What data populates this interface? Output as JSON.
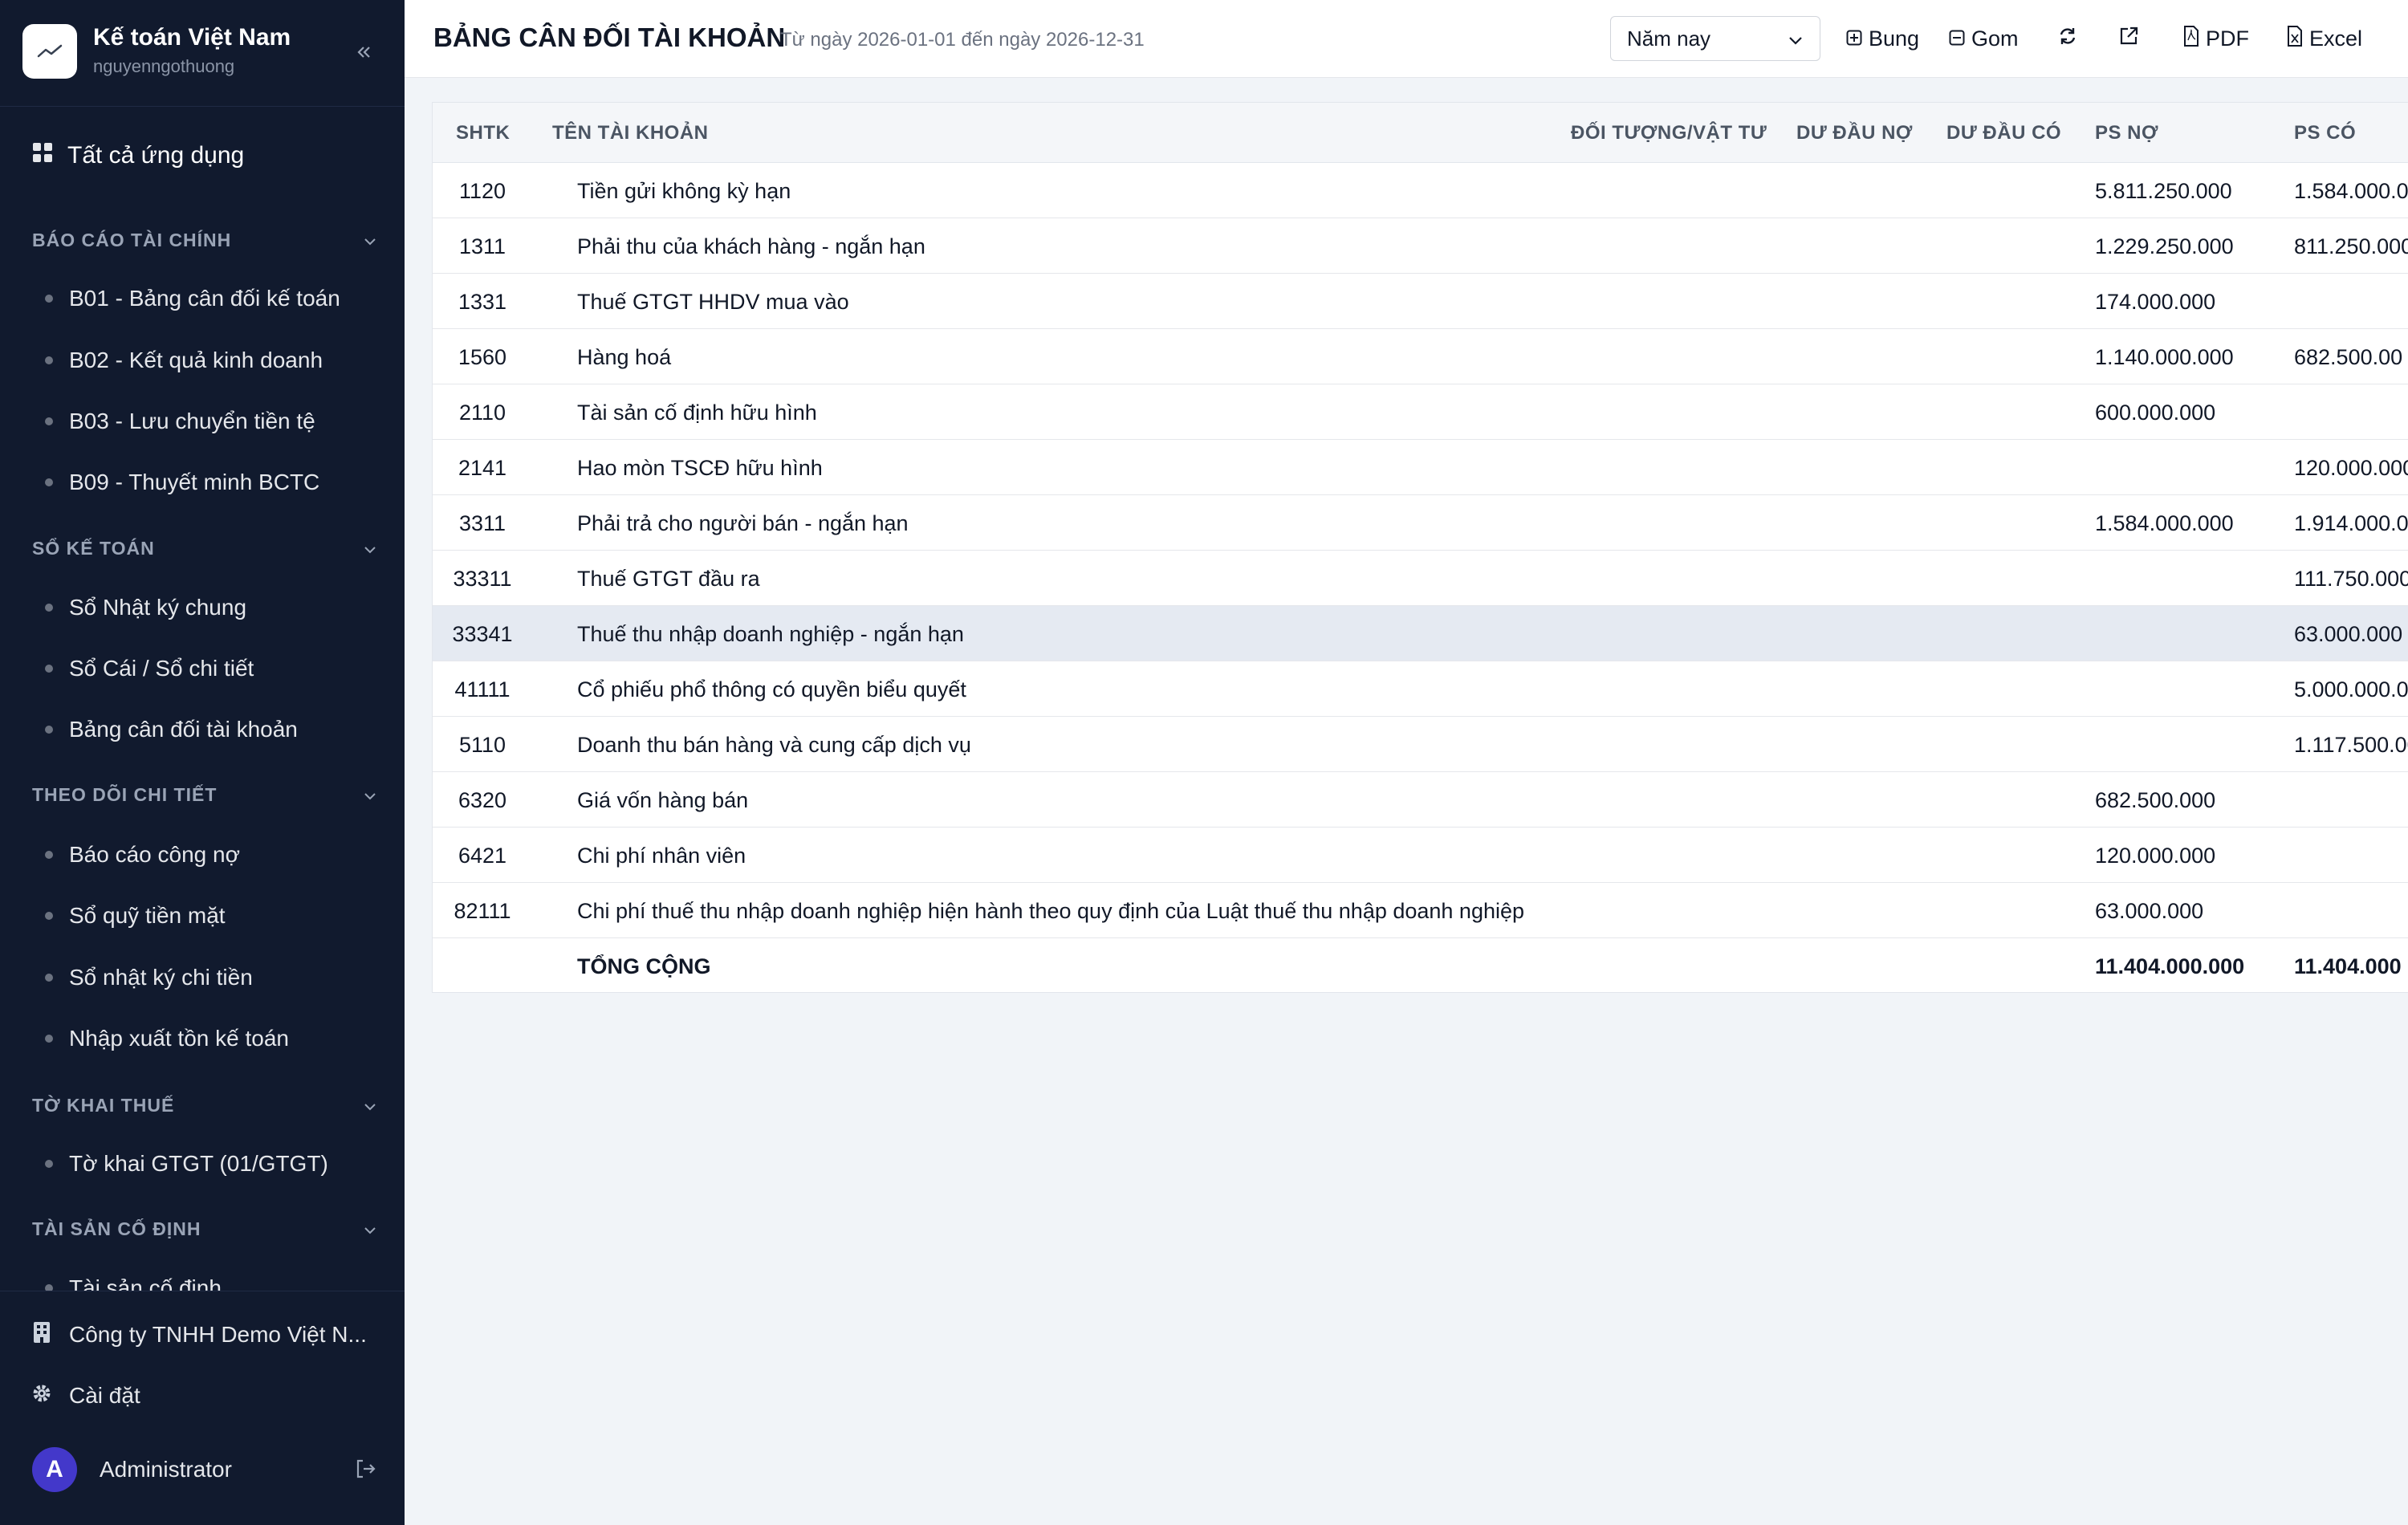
{
  "sidebar": {
    "brand_title": "Kế toán Việt Nam",
    "brand_sub": "nguyenngothuong",
    "all_apps": "Tất cả ứng dụng",
    "sections": [
      {
        "title": "BÁO CÁO TÀI CHÍNH",
        "items": [
          "B01 - Bảng cân đối kế toán",
          "B02 - Kết quả kinh doanh",
          "B03 - Lưu chuyển tiền tệ",
          "B09 - Thuyết minh BCTC"
        ]
      },
      {
        "title": "SỔ KẾ TOÁN",
        "items": [
          "Sổ Nhật ký chung",
          "Sổ Cái / Sổ chi tiết",
          "Bảng cân đối tài khoản"
        ]
      },
      {
        "title": "THEO DÕI CHI TIẾT",
        "items": [
          "Báo cáo công nợ",
          "Sổ quỹ tiền mặt",
          "Sổ nhật ký chi tiền",
          "Nhập xuất tồn kế toán"
        ]
      },
      {
        "title": "TỜ KHAI THUẾ",
        "items": [
          "Tờ khai GTGT (01/GTGT)"
        ]
      },
      {
        "title": "TÀI SẢN CỐ ĐỊNH",
        "items": [
          "Tài sản cố định"
        ]
      }
    ],
    "company": "Công ty TNHH Demo Việt N...",
    "settings": "Cài đặt",
    "user_initial": "A",
    "user_name": "Administrator"
  },
  "header": {
    "title": "BẢNG CÂN ĐỐI TÀI KHOẢN",
    "subtitle": "Từ ngày 2026-01-01 đến ngày 2026-12-31",
    "period": "Năm nay",
    "expand": "Bung",
    "collapse": "Gom",
    "pdf": "PDF",
    "excel": "Excel"
  },
  "table": {
    "columns": [
      "SHTK",
      "TÊN TÀI KHOẢN",
      "ĐỐI TƯỢNG/VẬT TƯ",
      "DƯ ĐẦU NỢ",
      "DƯ ĐẦU CÓ",
      "PS NỢ",
      "PS CÓ"
    ],
    "rows": [
      {
        "code": "1120",
        "name": "Tiền gửi không kỳ hạn",
        "ps_no": "5.811.250.000",
        "ps_co": "1.584.000.0"
      },
      {
        "code": "1311",
        "name": "Phải thu của khách hàng - ngắn hạn",
        "ps_no": "1.229.250.000",
        "ps_co": "811.250.000"
      },
      {
        "code": "1331",
        "name": "Thuế GTGT HHDV mua vào",
        "ps_no": "174.000.000",
        "ps_co": ""
      },
      {
        "code": "1560",
        "name": "Hàng hoá",
        "ps_no": "1.140.000.000",
        "ps_co": "682.500.00"
      },
      {
        "code": "2110",
        "name": "Tài sản cố định hữu hình",
        "ps_no": "600.000.000",
        "ps_co": ""
      },
      {
        "code": "2141",
        "name": "Hao mòn TSCĐ hữu hình",
        "ps_no": "",
        "ps_co": "120.000.000"
      },
      {
        "code": "3311",
        "name": "Phải trả cho người bán - ngắn hạn",
        "ps_no": "1.584.000.000",
        "ps_co": "1.914.000.0"
      },
      {
        "code": "33311",
        "name": "Thuế GTGT đầu ra",
        "ps_no": "",
        "ps_co": "111.750.000"
      },
      {
        "code": "33341",
        "name": "Thuế thu nhập doanh nghiệp - ngắn hạn",
        "ps_no": "",
        "ps_co": "63.000.000"
      },
      {
        "code": "41111",
        "name": "Cổ phiếu phổ thông có quyền biểu quyết",
        "ps_no": "",
        "ps_co": "5.000.000.0"
      },
      {
        "code": "5110",
        "name": "Doanh thu bán hàng và cung cấp dịch vụ",
        "ps_no": "",
        "ps_co": "1.117.500.00"
      },
      {
        "code": "6320",
        "name": "Giá vốn hàng bán",
        "ps_no": "682.500.000",
        "ps_co": ""
      },
      {
        "code": "6421",
        "name": "Chi phí nhân viên",
        "ps_no": "120.000.000",
        "ps_co": ""
      },
      {
        "code": "82111",
        "name": "Chi phí thuế thu nhập doanh nghiệp hiện hành theo quy định của Luật thuế thu nhập doanh nghiệp",
        "ps_no": "63.000.000",
        "ps_co": ""
      }
    ],
    "total": {
      "label": "TỔNG CỘNG",
      "ps_no": "11.404.000.000",
      "ps_co": "11.404.000"
    }
  }
}
